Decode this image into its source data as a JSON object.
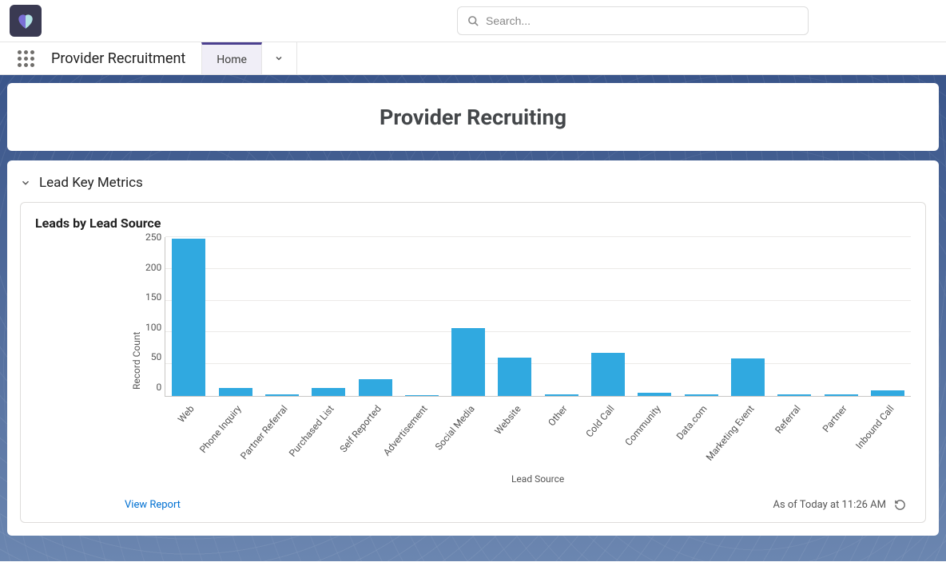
{
  "header": {
    "search_placeholder": "Search..."
  },
  "nav": {
    "app_name": "Provider Recruitment",
    "active_tab": "Home"
  },
  "page": {
    "title": "Provider Recruiting"
  },
  "section": {
    "title": "Lead Key Metrics"
  },
  "chart": {
    "title": "Leads by Lead Source",
    "view_report_label": "View Report",
    "timestamp": "As of Today at 11:26 AM"
  },
  "chart_data": {
    "type": "bar",
    "title": "Leads by Lead Source",
    "xlabel": "Lead Source",
    "ylabel": "Record Count",
    "ylim": [
      0,
      250
    ],
    "yticks": [
      0,
      50,
      100,
      150,
      200,
      250
    ],
    "categories": [
      "Web",
      "Phone Inquiry",
      "Partner Referral",
      "Purchased List",
      "Self Reported",
      "Advertisement",
      "Social Media",
      "Website",
      "Other",
      "Cold Call",
      "Community",
      "Data.com",
      "Marketing Event",
      "Referral",
      "Partner",
      "Inbound Call"
    ],
    "values": [
      248,
      12,
      3,
      12,
      26,
      1,
      107,
      60,
      3,
      68,
      5,
      3,
      59,
      3,
      2,
      9
    ]
  },
  "colors": {
    "bar": "#30a9e0",
    "accent": "#4b3f8f",
    "link": "#0070d2"
  }
}
